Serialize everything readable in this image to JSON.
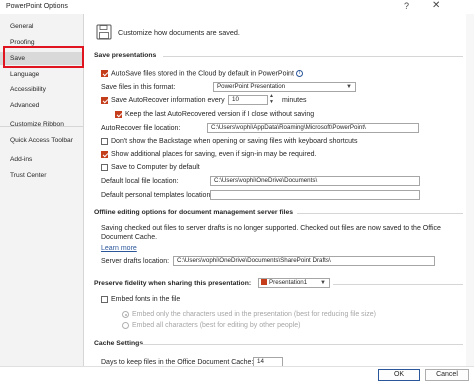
{
  "window": {
    "title": "PowerPoint Options",
    "help": "?",
    "close": "✕"
  },
  "sidebar": {
    "items": [
      {
        "label": "General"
      },
      {
        "label": "Proofing"
      },
      {
        "label": "Save"
      },
      {
        "label": "Language"
      },
      {
        "label": "Accessibility"
      },
      {
        "label": "Advanced"
      },
      {
        "label": "Customize Ribbon"
      },
      {
        "label": "Quick Access Toolbar"
      },
      {
        "label": "Add-ins"
      },
      {
        "label": "Trust Center"
      }
    ],
    "selected": "Save",
    "highlight_color": "#e0141e"
  },
  "main": {
    "header": "Customize how documents are saved.",
    "save": {
      "title": "Save presentations",
      "autosave": "AutoSave files stored in the Cloud by default in PowerPoint",
      "format_label": "Save files in this format:",
      "format_value": "PowerPoint Presentation",
      "autorecover_label": "Save AutoRecover information every",
      "autorecover_minutes": "10",
      "minutes": "minutes",
      "keep_last": "Keep the last AutoRecovered version if I close without saving",
      "autorecover_location_label": "AutoRecover file location:",
      "autorecover_location_value": "C:\\Users\\vophi\\AppData\\Roaming\\Microsoft\\PowerPoint\\",
      "dont_show_backstage": "Don't show the Backstage when opening or saving files with keyboard shortcuts",
      "show_additional": "Show additional places for saving, even if sign-in may be required.",
      "save_to_computer": "Save to Computer by default",
      "default_local_label": "Default local file location:",
      "default_local_value": "C:\\Users\\vophi\\OneDrive\\Documents\\",
      "templates_label": "Default personal templates location:",
      "templates_value": ""
    },
    "offline": {
      "title": "Offline editing options for document management server files",
      "text1": "Saving checked out files to server drafts is no longer supported. Checked out files are now saved to the Office",
      "text2": "Document Cache.",
      "learn_more": "Learn more",
      "drafts_label": "Server drafts location:",
      "drafts_value": "C:\\Users\\vophi\\OneDrive\\Documents\\SharePoint Drafts\\"
    },
    "fidelity": {
      "title": "Preserve fidelity when sharing this presentation:",
      "presentation": "Presentation1",
      "embed_fonts": "Embed fonts in the file",
      "embed_only": "Embed only the characters used in the presentation (best for reducing file size)",
      "embed_all": "Embed all characters (best for editing by other people)"
    },
    "cache": {
      "title": "Cache Settings",
      "days_label": "Days to keep files in the Office Document Cache:",
      "days_value": "14"
    }
  },
  "footer": {
    "ok": "OK",
    "cancel": "Cancel"
  },
  "colors": {
    "accent": "#c43e1c",
    "link": "#2b579a"
  }
}
